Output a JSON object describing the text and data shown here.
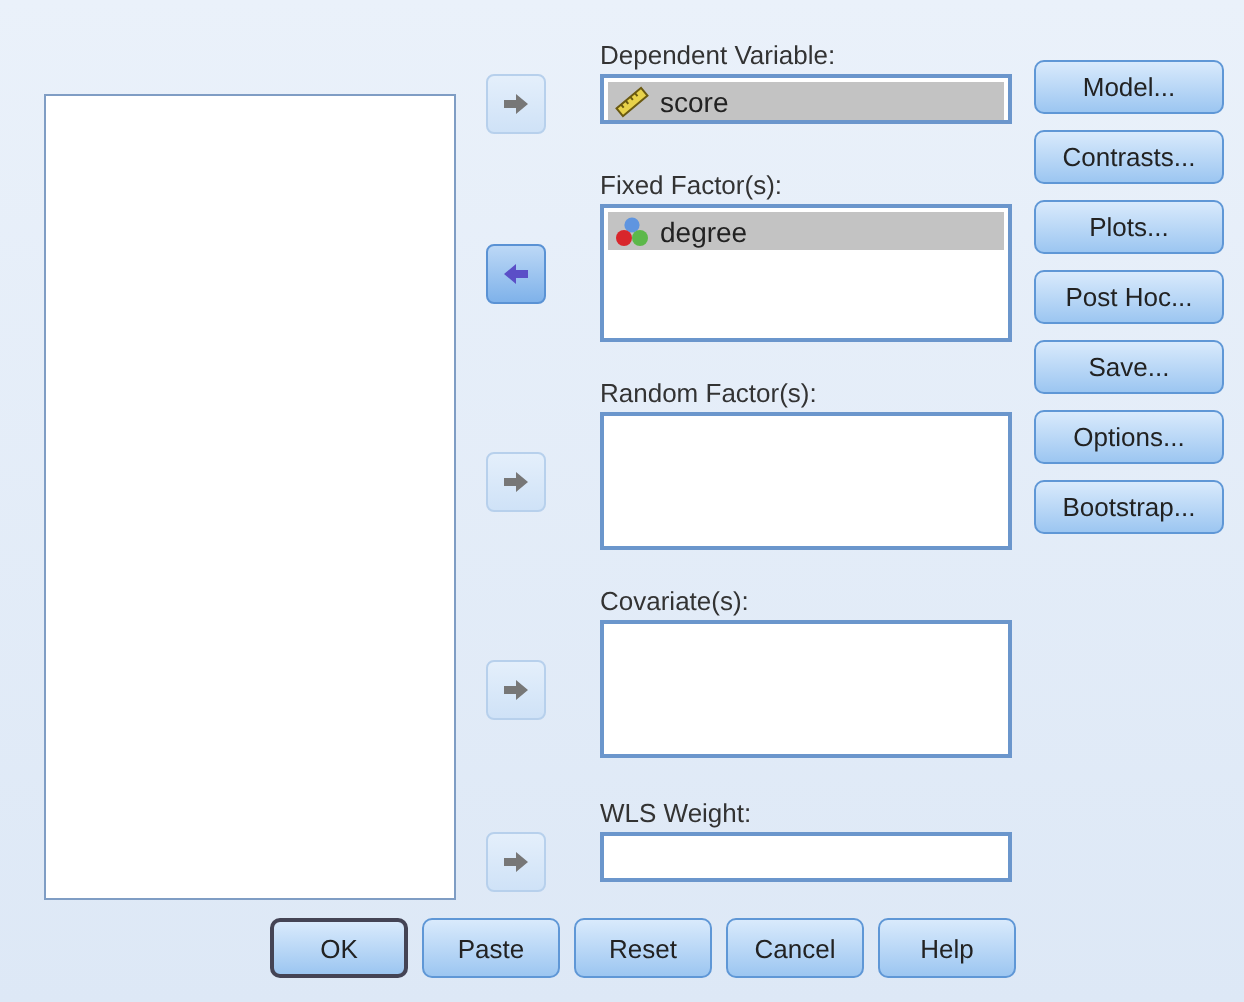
{
  "targets": [
    {
      "label": "Dependent Variable:",
      "kind": "single",
      "arrow": {
        "kind": "add",
        "disabled": true
      },
      "items": [
        {
          "name": "score",
          "kind": "scale",
          "selected": true
        }
      ]
    },
    {
      "label": "Fixed Factor(s):",
      "kind": "list",
      "arrow": {
        "kind": "remove",
        "disabled": false
      },
      "items": [
        {
          "name": "degree",
          "kind": "nominal",
          "selected": true
        }
      ]
    },
    {
      "label": "Random Factor(s):",
      "kind": "list",
      "arrow": {
        "kind": "add",
        "disabled": true
      }
    },
    {
      "label": "Covariate(s):",
      "kind": "list",
      "arrow": {
        "kind": "add",
        "disabled": true
      }
    },
    {
      "label": "WLS Weight:",
      "kind": "single",
      "arrow": {
        "kind": "add",
        "disabled": true
      }
    }
  ],
  "side_buttons": [
    "Model...",
    "Contrasts...",
    "Plots...",
    "Post Hoc...",
    "Save...",
    "Options...",
    "Bootstrap..."
  ],
  "bottom_buttons": [
    {
      "label": "OK",
      "default": true
    },
    {
      "label": "Paste",
      "default": false
    },
    {
      "label": "Reset",
      "default": false
    },
    {
      "label": "Cancel",
      "default": false
    },
    {
      "label": "Help",
      "default": false
    }
  ]
}
